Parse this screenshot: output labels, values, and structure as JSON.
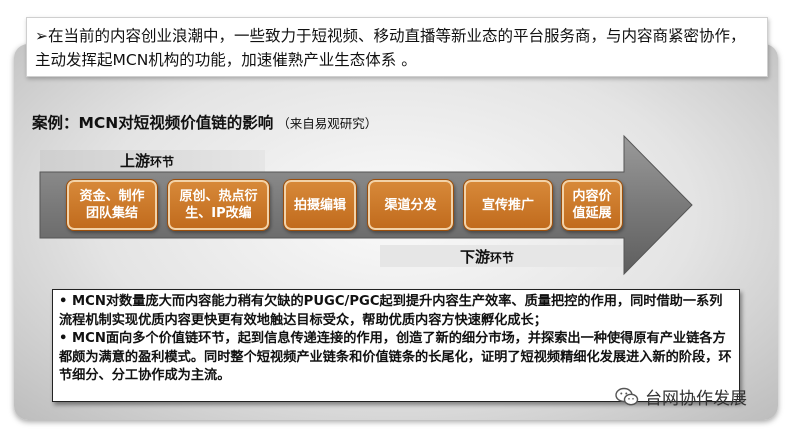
{
  "intro": {
    "bullet": "➢",
    "text": "在当前的内容创业浪潮中，一些致力于短视频、移动直播等新业态的平台服务商，与内容商紧密协作，主动发挥起MCN机构的功能，加速催熟产业生态体系 。"
  },
  "case": {
    "title": "案例：MCN对短视频价值链的影响",
    "source": "（来自易观研究）"
  },
  "chain": {
    "upstream_main": "上游",
    "upstream_sub": "环节",
    "downstream_main": "下游",
    "downstream_sub": "环节",
    "stages": [
      "资金、制作\n团队集结",
      "原创、热点衍\n生、IP改编",
      "拍摄编辑",
      "渠道分发",
      "宣传推广",
      "内容价\n值延展"
    ]
  },
  "notes": {
    "items": [
      "• MCN对数量庞大而内容能力稍有欠缺的PUGC/PGC起到提升内容生产效率、质量把控的作用，同时借助一系列流程机制实现优质内容更快更有效地触达目标受众，帮助优质内容方快速孵化成长；",
      "• MCN面向多个价值链环节，起到信息传递连接的作用，创造了新的细分市场，并探索出一种使得原有产业链各方都颇为满意的盈利模式。同时整个短视频产业链条和价值链条的长尾化，证明了短视频精细化发展进入新的阶段，环节细分、分工协作成为主流。"
    ]
  },
  "watermark": {
    "icon": "wechat-icon",
    "text": "台网协作发展"
  },
  "colors": {
    "stage": "#c87423",
    "arrow": "#7f7f7f",
    "panel": "#d9d9d9"
  }
}
